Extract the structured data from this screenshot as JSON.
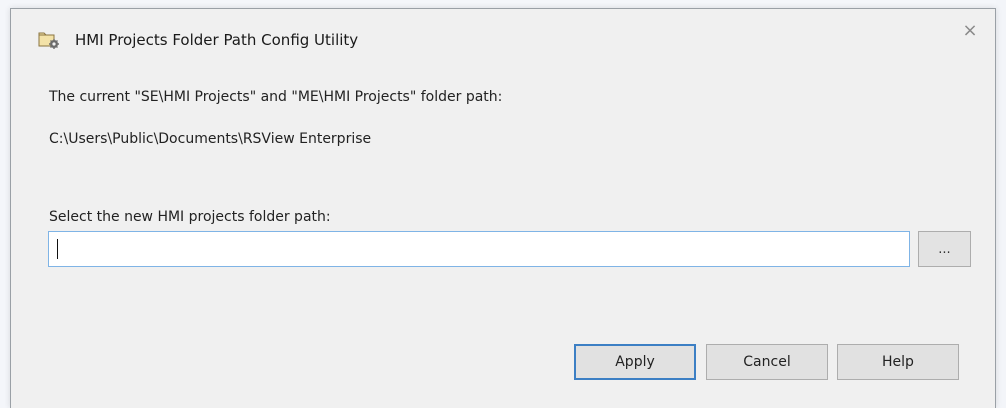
{
  "window": {
    "title": "HMI Projects Folder Path Config Utility",
    "icon": "folder-gear-icon",
    "close_glyph": "×"
  },
  "current": {
    "label": "The current \"SE\\HMI Projects\" and \"ME\\HMI Projects\" folder path:",
    "path": "C:\\Users\\Public\\Documents\\RSView Enterprise"
  },
  "select": {
    "label": "Select the new HMI projects folder path:",
    "value": "",
    "browse_label": "..."
  },
  "buttons": {
    "apply": "Apply",
    "cancel": "Cancel",
    "help": "Help"
  },
  "colors": {
    "dialog_bg": "#f0f0f0",
    "focus_border": "#3c7fc4",
    "input_border": "#7fb4e6"
  }
}
